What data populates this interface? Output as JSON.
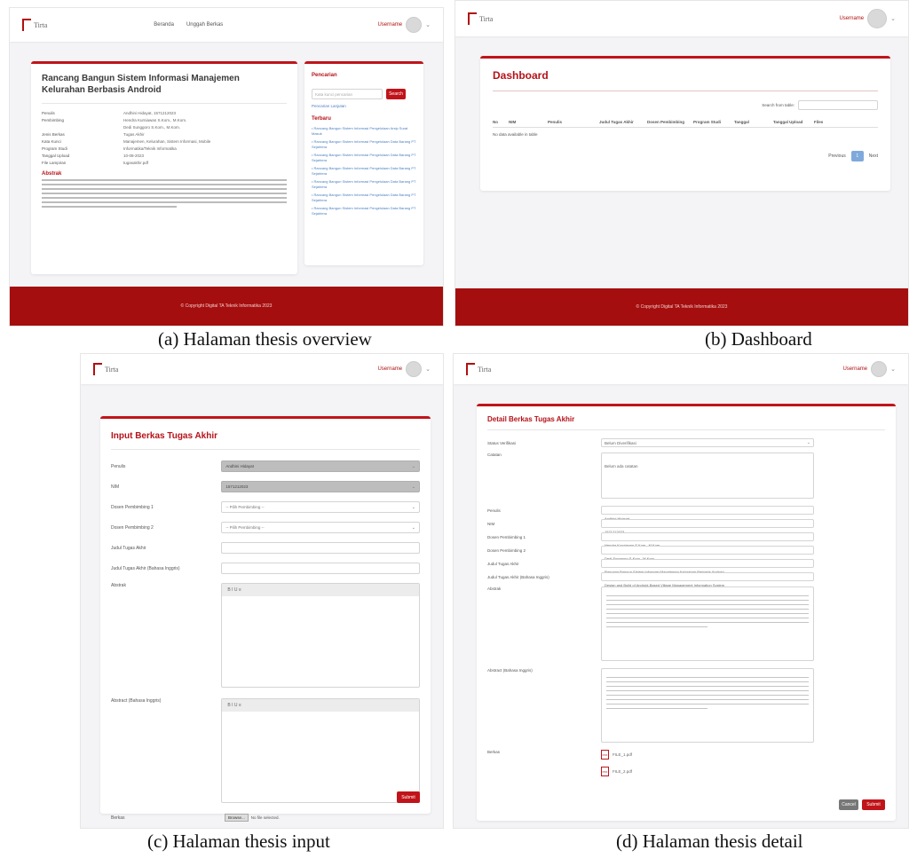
{
  "captions": {
    "a": "(a)  Halaman thesis overview",
    "b": "(b) Dashboard",
    "c": "(c) Halaman thesis input",
    "d": "(d) Halaman thesis detail"
  },
  "colors": {
    "accent": "#c0141a",
    "footer": "#a50e0e",
    "link": "#4a7fc1"
  },
  "app": {
    "logo_text": "Tirta",
    "user_name": "Username",
    "footer_text": "© Copyright Digital TA Teknik Informatika 2023",
    "nav": [
      "Beranda",
      "Unggah Berkas"
    ]
  },
  "overview": {
    "title": "Rancang Bangun Sistem Informasi Manajemen Kelurahan Berbasis Android",
    "fields": [
      {
        "label": "Penulis",
        "value": "Andhini Hidayat, 1571212023"
      },
      {
        "label": "Pembimbing",
        "value": "Hendra Kurniawan S.Kom., M.Kom."
      },
      {
        "label": "",
        "value": "Dedi Sunggoro S.Kom., M.Kom."
      },
      {
        "label": "Jenis Berkas",
        "value": "Tugas Akhir"
      },
      {
        "label": "Kata Kunci",
        "value": "Manajemen, Kelurahan, Sistem Informasi, Mobile"
      },
      {
        "label": "Program Studi",
        "value": "Informatika/Teknik Informatika"
      },
      {
        "label": "Tanggal Upload",
        "value": "10-08-2023"
      },
      {
        "label": "File Lampiran",
        "value": "tugasakhir.pdf"
      }
    ],
    "abstract_heading": "Abstrak",
    "abstract_lines": 7,
    "side_search_heading": "Pencarian",
    "side_search_placeholder": "Kata kunci pencarian",
    "side_search_button": "Search",
    "side_advanced_link": "Pencarian Lanjutan",
    "side_terbaru_heading": "Terbaru",
    "side_items": [
      "Rancang Bangun Sistem Informasi Pengelolaan Arsip Surat Masuk",
      "Rancang Bangun Sistem Informasi Pengelolaan Data Barang PT Sejahtera",
      "Rancang Bangun Sistem Informasi Pengelolaan Data Barang PT Sejahtera",
      "Rancang Bangun Sistem Informasi Pengelolaan Data Barang PT Sejahtera",
      "Rancang Bangun Sistem Informasi Pengelolaan Data Barang PT Sejahtera",
      "Rancang Bangun Sistem Informasi Pengelolaan Data Barang PT Sejahtera",
      "Rancang Bangun Sistem Informasi Pengelolaan Data Barang PT Sejahtera"
    ]
  },
  "dashboard": {
    "title": "Dashboard",
    "search_label": "Search from table:",
    "columns": [
      "No",
      "NIM",
      "Penulis",
      "Judul Tugas Akhir",
      "Dosen Pembimbing",
      "Program Studi",
      "Tanggal",
      "Tanggal Upload",
      "Files"
    ],
    "empty_text": "No data available in table",
    "pagination": {
      "prev": "Previous",
      "current": "1",
      "next": "Next"
    }
  },
  "input_page": {
    "title": "Input Berkas Tugas Akhir",
    "fields": [
      {
        "label": "Penulis",
        "value": "Andhini Hidayat",
        "kind": "grey"
      },
      {
        "label": "NIM",
        "value": "1571212023",
        "kind": "grey"
      },
      {
        "label": "Dosen Pembimbing 1",
        "value": "-- Pilih Pembimbing --",
        "kind": "select"
      },
      {
        "label": "Dosen Pembimbing 2",
        "value": "-- Pilih Pembimbing --",
        "kind": "select"
      },
      {
        "label": "Judul Tugas Akhir",
        "value": "",
        "kind": "text"
      },
      {
        "label": "Judul Tugas Akhir (Bahasa Inggris)",
        "value": "",
        "kind": "text"
      }
    ],
    "abstrak_label": "Abstrak",
    "abstract_en_label": "Abstract (Bahasa Inggris)",
    "editor_toolbar": "B  I  U  ≡",
    "berkas_label": "Berkas",
    "browse_button": "Browse...",
    "no_file": "No file selected.",
    "submit": "Submit"
  },
  "detail_page": {
    "title": "Detail Berkas Tugas Akhir",
    "status_label": "Status Verifikasi",
    "status_value": "Belum Diverifikasi",
    "catatan_label": "Catatan",
    "catatan_value": "Belum ada catatan",
    "fields": [
      {
        "label": "Penulis",
        "value": "Andhini Hidayat"
      },
      {
        "label": "NIM",
        "value": "1571212023"
      },
      {
        "label": "Dosen Pembimbing 1",
        "value": "Hendra Kurniawan S.Kom., M.Kom."
      },
      {
        "label": "Dosen Pembimbing 2",
        "value": "Dedi Sunggoro S.Kom., M.Kom."
      },
      {
        "label": "Judul Tugas Akhir",
        "value": "Rancang Bangun Sistem Informasi Manajemen Kelurahan Berbasis Android"
      },
      {
        "label": "Judul Tugas Akhir (Bahasa Inggris)",
        "value": "Design and Build of Android-Based Village Management Information System"
      }
    ],
    "abstrak_label": "Abstrak",
    "abstract_en_label": "Abstract (Bahasa Inggris)",
    "berkas_label": "Berkas",
    "files": [
      "FILE_1.pdf",
      "FILE_2.pdf"
    ],
    "cancel": "Cancel",
    "submit": "Submit"
  }
}
